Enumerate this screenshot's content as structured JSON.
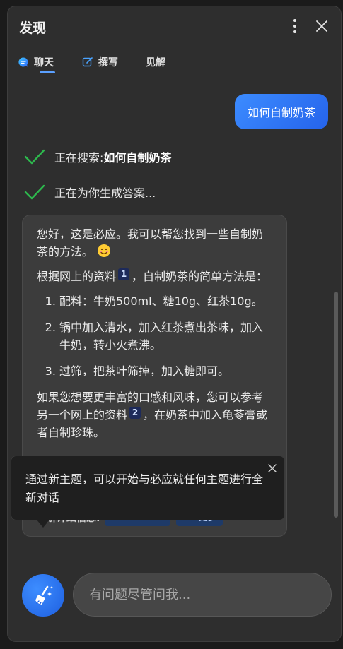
{
  "header": {
    "title": "发现"
  },
  "tabs": [
    {
      "label": "聊天",
      "icon": "chat-bubble-icon",
      "active": true
    },
    {
      "label": "撰写",
      "icon": "compose-pen-icon",
      "active": false
    },
    {
      "label": "见解",
      "icon": "",
      "active": false
    }
  ],
  "chat": {
    "user_message": "如何自制奶茶",
    "status_searching_prefix": "正在搜索: ",
    "status_searching_query": "如何自制奶茶",
    "status_generating": "正在为你生成答案...",
    "answer": {
      "greeting": "您好，这是必应。我可以帮您找到一些自制奶茶的方法。",
      "intro_before": "根据网上的资料",
      "intro_cite": "1",
      "intro_after": "，自制奶茶的简单方法是：",
      "steps": [
        "配料：牛奶500ml、糖10g、红茶10g。",
        "锅中加入清水，加入红茶煮出茶味，加入牛奶，转小火煮沸。",
        "过筛，把茶叶筛掉，加入糖即可。"
      ],
      "outro_before": "如果您想要更丰富的口感和风味，您可以参考另一个网上的资料",
      "outro_cite": "2",
      "outro_after": "，在奶茶中加入龟苓膏或者自制珍珠。",
      "learn_more_label": "了解详细信息:",
      "learn_more_links": [
        "1. ufun.com",
        "+1 更多"
      ]
    }
  },
  "tooltip": {
    "text": "通过新主题，可以开始与必应就任何主题进行全新对话"
  },
  "composer": {
    "placeholder": "有问题尽管问我..."
  },
  "colors": {
    "accent": "#2f7bff",
    "check": "#2db84d",
    "background": "#2e2e2e"
  }
}
